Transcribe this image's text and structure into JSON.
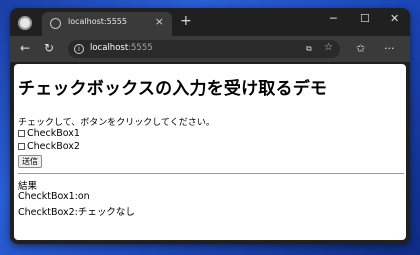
{
  "browser": {
    "tab_title": "localhost:5555",
    "tab_close": "×",
    "new_tab": "+",
    "url_host": "localhost",
    "url_port": ":5555",
    "window_controls": {
      "minimize": "─",
      "maximize": "☐",
      "close": "✕"
    }
  },
  "page": {
    "title": "チェックボックスの入力を受け取るデモ",
    "instruction": "チェックして、ボタンをクリックしてください。",
    "checkboxes": [
      {
        "label": "CheckBox1",
        "checked": false
      },
      {
        "label": "CheckBox2",
        "checked": false
      }
    ],
    "submit_label": "送信",
    "result_heading": "結果",
    "results": [
      "ChecktBox1:on",
      "ChecktBox2:チェックなし"
    ]
  },
  "colors": {
    "desktop_accent": "#2a5fd6",
    "browser_chrome": "#202020",
    "toolbar": "#3a3a3a"
  },
  "icons": [
    "browser-app-icon",
    "tab-favicon",
    "back-icon",
    "refresh-icon",
    "site-info-icon",
    "reader-mode-icon",
    "favorite-star-icon",
    "favorites-icon",
    "more-icon"
  ]
}
